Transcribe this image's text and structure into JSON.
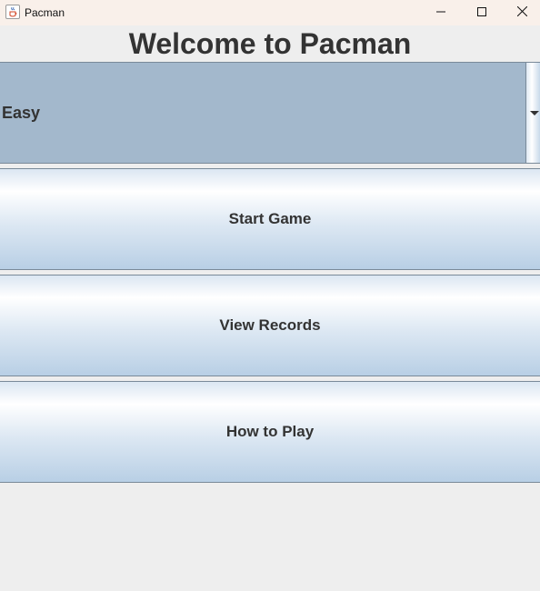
{
  "window": {
    "title": "Pacman"
  },
  "heading": "Welcome to Pacman",
  "difficulty": {
    "selected": "Easy"
  },
  "buttons": {
    "start": "Start Game",
    "records": "View Records",
    "howto": "How to Play"
  },
  "icons": {
    "app": "java-coffee-icon",
    "minimize": "minimize-icon",
    "maximize": "maximize-icon",
    "close": "close-icon",
    "dropdown": "chevron-down-icon"
  },
  "colors": {
    "titlebar": "#f9f0ea",
    "background": "#eeeeee",
    "combo_selected": "#a3b8cc",
    "text": "#333333",
    "border": "#7a8a99"
  }
}
